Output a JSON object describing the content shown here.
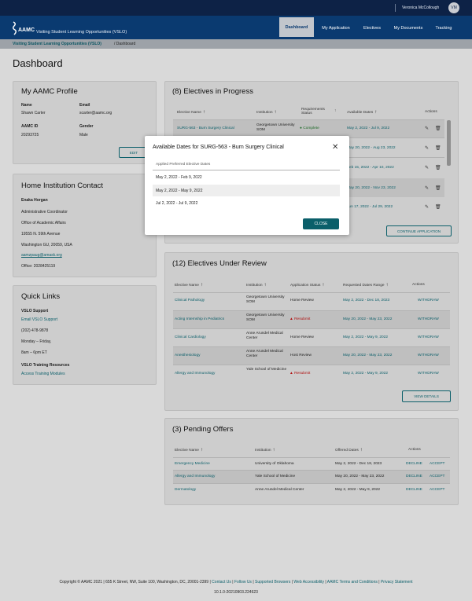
{
  "topbar": {
    "user": "Veronica McCollough",
    "avatar": "VM"
  },
  "logo_text": "AAMC",
  "app_title": "Visiting Student Learning Opportunities (VSLO)",
  "nav": [
    {
      "label": "Dashboard"
    },
    {
      "label": "My Application"
    },
    {
      "label": "Electives"
    },
    {
      "label": "My Documents"
    },
    {
      "label": "Tracking"
    }
  ],
  "breadcrumb": {
    "root": "Visiting Student Learning Opportunities (VSLO)",
    "current": "/ Dashboard"
  },
  "page_title": "Dashboard",
  "profile": {
    "title": "My AAMC Profile",
    "name_label": "Name",
    "name": "Shawn Carter",
    "email_label": "Email",
    "email": "scarter@aamc.org",
    "id_label": "AAMC ID",
    "id": "20293725",
    "gender_label": "Gender",
    "gender": "Male",
    "edit": "EDIT"
  },
  "home": {
    "title": "Home Institution Contact",
    "name": "Enaka Horgan",
    "role": "Administrative Coordinator",
    "office": "Office of Academic Affairs",
    "street": "19555 N. 59th Avenue",
    "city": "Washington GU, 20059, USA",
    "email": "aamzpaug@amask.org",
    "phone": "Office: 2028425119"
  },
  "links": {
    "title": "Quick Links",
    "support_h": "VSLO Support",
    "support_link": "Email VSLO Support",
    "phone": "(202) 478-9878",
    "days": "Monday – Friday,",
    "hours": "8am – 6pm ET",
    "training_h": "VSLO Training Resources",
    "training_link": "Access Training Modules"
  },
  "progress": {
    "title": "(8) Electives in Progress",
    "headers": [
      "Elective Name",
      "Institution",
      "Requirements Status",
      "Available Dates",
      "Actions"
    ],
    "rows": [
      {
        "name": "SURG-563 - Burn Surgery Clinical",
        "inst": "Georgetown University SOM",
        "status": "Complete",
        "dates": "May 2, 2022 - Jul 9, 2022"
      },
      {
        "dates": "May 20, 2022 - Aug 23, 2022"
      },
      {
        "dates": "Feb 15, 2022 - Apr 10, 2022"
      },
      {
        "dates": "May 20, 2022 - Nov 23, 2022"
      },
      {
        "dates": "Jun 17, 2022 - Jul 29, 2022"
      }
    ],
    "continue": "CONTINUE APPLICATION"
  },
  "review": {
    "title": "(12) Electives Under Review",
    "headers": [
      "Elective Name",
      "Institution",
      "Application Status",
      "Requested Dates Range",
      "Actions"
    ],
    "rows": [
      {
        "name": "Clinical Pathology",
        "inst": "Georgetown University SOM",
        "status": "Home Review",
        "dates": "May 2, 2022 - Dec 18, 2023",
        "action": "WITHDRAW"
      },
      {
        "name": "Acting Internship in Pediatrics",
        "inst": "Georgetown University SOM",
        "status": "Resubmit",
        "dates": "May 20, 2022 - May 23, 2022",
        "action": "WITHDRAW"
      },
      {
        "name": "Clinical Cardiology",
        "inst": "Anne Arundel Medical Center",
        "status": "Home Review",
        "dates": "May 2, 2022 - May 9, 2022",
        "action": "WITHDRAW"
      },
      {
        "name": "Anesthesiology",
        "inst": "Anne Arundel Medical Center",
        "status": "Host Review",
        "dates": "May 20, 2022 - May 23, 2022",
        "action": "WITHDRAW"
      },
      {
        "name": "Allergy and Immunology",
        "inst": "Yale School of Medicine",
        "status": "Resubmit",
        "dates": "May 2, 2022 - May 9, 2022",
        "action": "WITHDRAW"
      }
    ],
    "view": "VIEW DETAILS"
  },
  "offers": {
    "title": "(3) Pending Offers",
    "headers": [
      "Elective Name",
      "Institution",
      "Offered Dates",
      "Actions"
    ],
    "rows": [
      {
        "name": "Emergency Medicine",
        "inst": "University of Oklahoma",
        "dates": "May 2, 2022 - Dec 18, 2023",
        "decline": "DECLINE",
        "accept": "ACCEPT"
      },
      {
        "name": "Allergy and Immunology",
        "inst": "Yale School of Medicine",
        "dates": "May 20, 2022 - May 23, 2022",
        "decline": "DECLINE",
        "accept": "ACCEPT"
      },
      {
        "name": "Dermatology",
        "inst": "Anne Arundel Medical Center",
        "dates": "May 2, 2022 - May 9, 2022",
        "decline": "DECLINE",
        "accept": "ACCEPT"
      }
    ]
  },
  "modal": {
    "title": "Available Dates for SURG-563 - Burn Surgery Clinical",
    "col": "Applied Preferred Elective Dates",
    "rows": [
      "May 2, 2022 - Feb 9, 2022",
      "May 2, 2022 - May 9, 2022",
      "Jul 2, 2022 - Jul 9, 2022"
    ],
    "close": "CLOSE"
  },
  "footer": {
    "copy": "Copyright © AAMC 2021 | 655 K Street, NW, Suite 100, Washington, DC, 20001-2399 |",
    "links": [
      "Contact Us",
      "Follow Us",
      "Supported Browsers",
      "Web Accessibility",
      "AAMC Terms and Conditions",
      "Privacy Statement"
    ],
    "version": "10.1.0-20210903.224623"
  }
}
